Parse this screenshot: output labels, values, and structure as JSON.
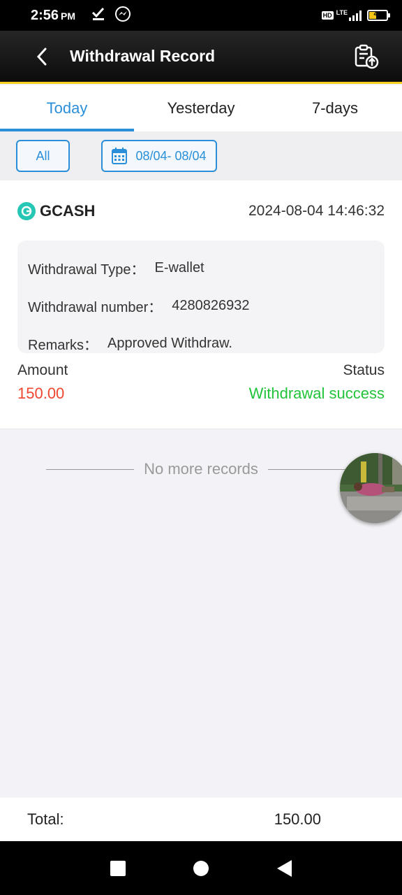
{
  "status_bar": {
    "time": "2:56",
    "ampm": "PM",
    "network": "HD",
    "lte": "LTE",
    "battery": "41"
  },
  "header": {
    "title": "Withdrawal Record"
  },
  "tabs": [
    {
      "label": "Today",
      "active": true
    },
    {
      "label": "Yesterday",
      "active": false
    },
    {
      "label": "7-days",
      "active": false
    }
  ],
  "filters": {
    "all_label": "All",
    "date_range": "08/04- 08/04"
  },
  "record": {
    "provider": "GCASH",
    "datetime": "2024-08-04 14:46:32",
    "withdrawal_type_label": "Withdrawal Type：",
    "withdrawal_type_value": "E-wallet",
    "withdrawal_number_label": "Withdrawal number：",
    "withdrawal_number_value": "4280826932",
    "remarks_label": "Remarks：",
    "remarks_value": "Approved Withdraw.",
    "amount_label": "Amount",
    "amount_value": "150.00",
    "status_label": "Status",
    "status_value": "Withdrawal success"
  },
  "list_footer": "No more records",
  "total": {
    "label": "Total:",
    "value": "150.00"
  },
  "colors": {
    "accent": "#2a8fd8",
    "amount": "#f0452e",
    "success": "#21c33a",
    "header_underline": "#f4d21f"
  }
}
